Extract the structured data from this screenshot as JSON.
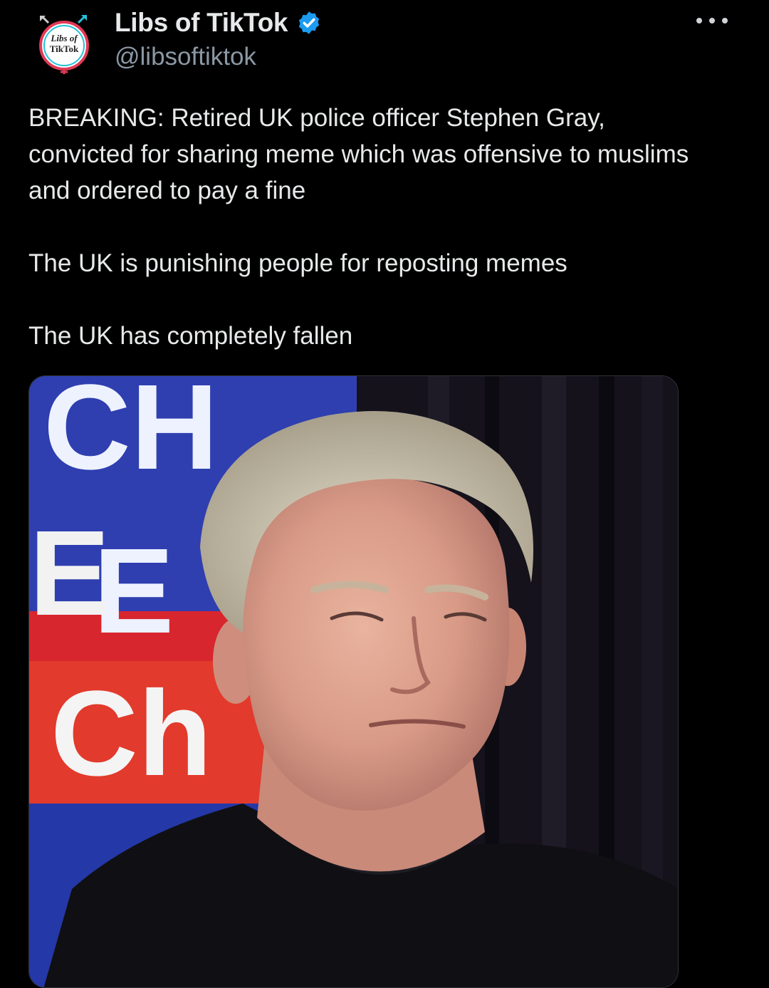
{
  "author": {
    "display_name": "Libs of TikTok",
    "handle": "@libsoftiktok",
    "verified": true,
    "verified_color": "#1d9bf0",
    "avatar_text_line1": "Libs of",
    "avatar_text_line2": "TikTok"
  },
  "tweet": {
    "paragraphs": [
      "BREAKING: Retired UK police officer Stephen Gray, convicted for sharing meme which was offensive to muslims and ordered to pay a fine",
      "The UK is punishing people for reposting memes",
      "The UK has completely fallen"
    ]
  },
  "icons": {
    "verified": "verified-badge-icon",
    "more": "more-options-icon"
  },
  "colors": {
    "background": "#000000",
    "text": "#e7e9ea",
    "secondary_text": "#8b98a5"
  }
}
